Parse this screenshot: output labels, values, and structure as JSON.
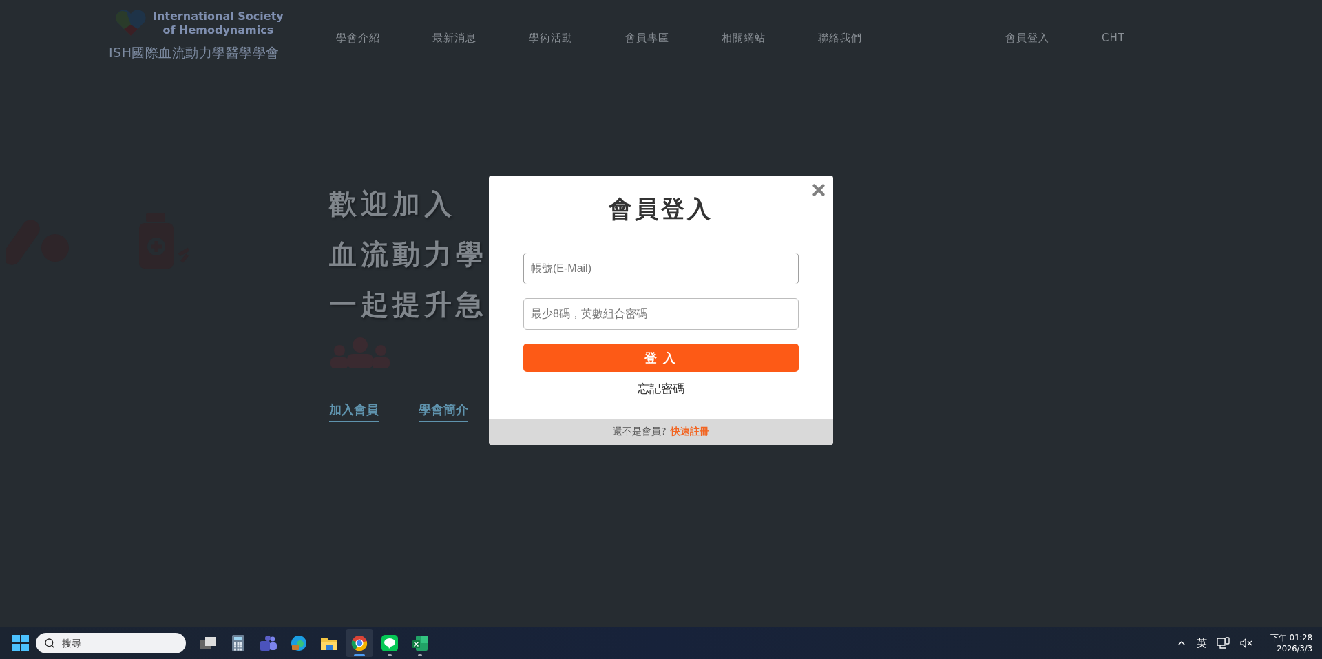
{
  "header": {
    "logo": {
      "line1": "International Society",
      "line2": "of Hemodynamics"
    },
    "subtitle": "ISH國際血流動力學醫學學會",
    "nav": [
      "學會介紹",
      "最新消息",
      "學術活動",
      "會員專區",
      "相關網站",
      "聯絡我們"
    ],
    "login": "會員登入",
    "language": "CHT"
  },
  "hero": {
    "lines": [
      "歡迎加入",
      "血流動力學",
      "一起提升急"
    ],
    "links": [
      "加入會員",
      "學會簡介"
    ]
  },
  "modal": {
    "title": "會員登入",
    "fields": [
      {
        "placeholder": "帳號(E-Mail)",
        "focused": true
      },
      {
        "placeholder": "最少8碼，英數組合密碼",
        "focused": false
      }
    ],
    "submit": "登 入",
    "forgot": "忘記密碼",
    "footer": {
      "text": "還不是會員?",
      "link": "快速註冊"
    }
  },
  "taskbar": {
    "search": {
      "placeholder": "搜尋"
    },
    "apps": [
      {
        "kind": "taskview",
        "selected": false,
        "running": false
      },
      {
        "kind": "calculator",
        "selected": false,
        "running": false
      },
      {
        "kind": "teams",
        "selected": false,
        "running": false
      },
      {
        "kind": "edge",
        "selected": false,
        "running": false
      },
      {
        "kind": "folder",
        "selected": false,
        "running": false
      },
      {
        "kind": "chrome",
        "selected": true,
        "running": true
      },
      {
        "kind": "line",
        "selected": false,
        "running": true
      },
      {
        "kind": "excel",
        "selected": false,
        "running": true
      }
    ],
    "tray": {
      "ime": "英",
      "time": "下午 01:28",
      "date": "2026/3/3"
    }
  }
}
